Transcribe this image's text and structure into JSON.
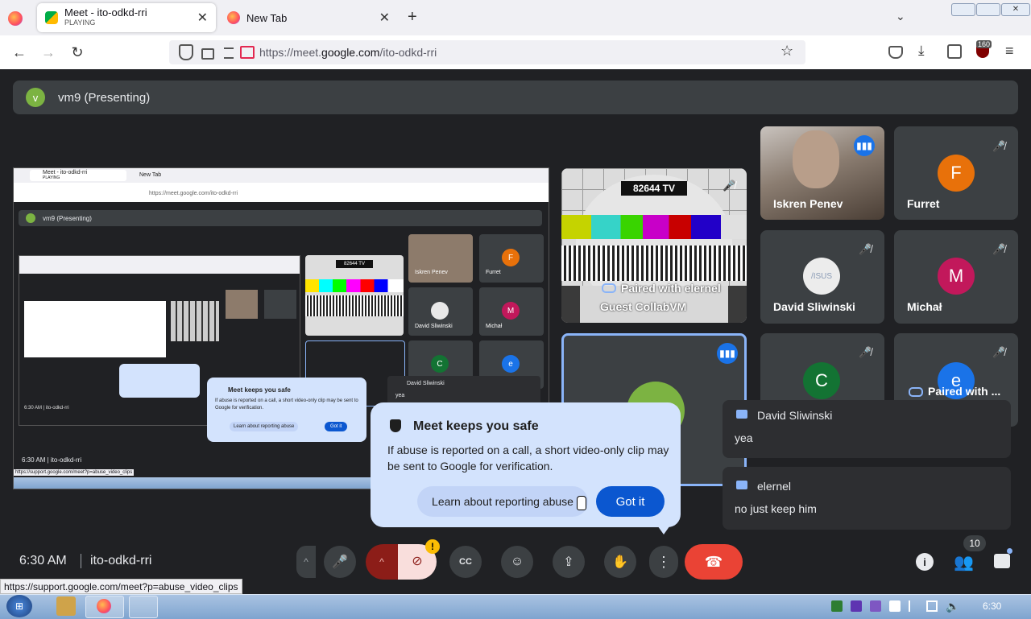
{
  "browser": {
    "tabs": [
      {
        "title": "Meet - ito-odkd-rri",
        "subtitle": "PLAYING"
      },
      {
        "title": "New Tab"
      }
    ],
    "url_prefix": "https://meet.",
    "url_domain": "google.com",
    "url_path": "/ito-odkd-rri",
    "badge_count": "160"
  },
  "meet": {
    "presenter_initial": "v",
    "presenter_label": "vm9 (Presenting)",
    "time": "6:30 AM",
    "meeting_code": "ito-odkd-rri",
    "participant_count": "10"
  },
  "tv": {
    "channel": "82644 TV",
    "paired_text": "Paired with elernel",
    "guest_name": "Guest CollabVM"
  },
  "participants": [
    {
      "name": "Iskren Penev"
    },
    {
      "name": "Furret",
      "initial": "F",
      "color": "#e8710a"
    },
    {
      "name": "David Sliwinski"
    },
    {
      "name": "Michał",
      "initial": "M",
      "color": "#c2185b"
    },
    {
      "name": "",
      "initial": "C",
      "color": "#137333"
    },
    {
      "name": "Paired with ...",
      "initial": "e",
      "color": "#1a73e8"
    }
  ],
  "popup": {
    "title": "Meet keeps you safe",
    "body": "If abuse is reported on a call, a short video-only clip may be sent to Google for verification.",
    "learn_label": "Learn about reporting abuse",
    "got_it_label": "Got it"
  },
  "chat": [
    {
      "sender": "David Sliwinski",
      "text": "yea"
    },
    {
      "sender": "elernel",
      "text": "no just keep him"
    }
  ],
  "status_url": "https://support.google.com/meet?p=abuse_video_clips",
  "taskbar": {
    "clock": "6:30"
  },
  "inner": {
    "tab1": "Meet - ito-odkd-rri",
    "tab1_sub": "PLAYING",
    "tab2": "New Tab",
    "url": "https://meet.google.com/ito-odkd-rri",
    "presenting": "vm9 (Presenting)",
    "p1": "Iskren Penev",
    "p2": "Furret",
    "p3": "David Sliwinski",
    "p4": "Michał",
    "popup_title": "Meet keeps you safe",
    "popup_body": "If abuse is reported on a call, a short video-only clip may be sent to Google for verification.",
    "learn": "Learn about reporting abuse",
    "gotit": "Got it",
    "chat_sender": "David Sliwinski",
    "chat_text": "yea",
    "time": "6:30 AM",
    "code": "ito-odkd-rri",
    "status": "https://support.google.com/meet?p=abuse_video_clips"
  }
}
